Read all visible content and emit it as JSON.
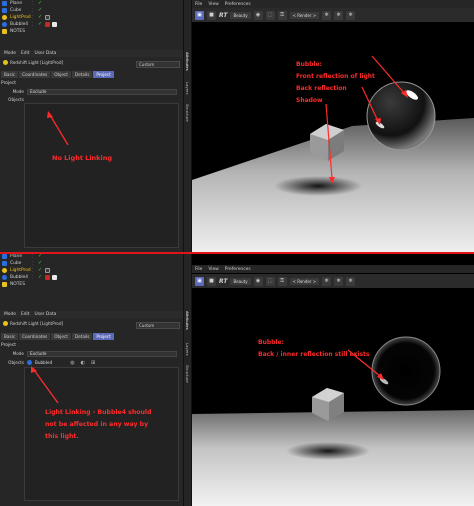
{
  "top": {
    "objects": [
      {
        "name": "Plane",
        "color": "#2a6ee0",
        "tags": []
      },
      {
        "name": "Cube",
        "color": "#2a6ee0",
        "tags": []
      },
      {
        "name": "LightProd",
        "color": "#e8c21c",
        "tags": [
          "dark"
        ]
      },
      {
        "name": "Bubble4",
        "color": "#2a6ee0",
        "tags": [
          "red",
          "white"
        ]
      },
      {
        "name": "NOTES",
        "color": "#e8c21c",
        "tags": []
      }
    ],
    "menu": [
      "Mode",
      "Edit",
      "User Data"
    ],
    "object_title": "Redshift Light [LightProd]",
    "layout_select": "Custom",
    "tabs": [
      {
        "label": "Basic",
        "active": false
      },
      {
        "label": "Coordinates",
        "active": false
      },
      {
        "label": "Object",
        "active": false
      },
      {
        "label": "Details",
        "active": false
      },
      {
        "label": "Project",
        "active": true
      }
    ],
    "section": "Project",
    "mode_label": "Mode",
    "mode_value": "Exclude",
    "objects_label": "Objects",
    "annotation": "No Light Linking",
    "viewport": {
      "menu": [
        "File",
        "View",
        "Preferences"
      ],
      "renderer": "Beauty",
      "render_select": "< Render >",
      "rt": "RT",
      "annotations": [
        "Bubble:",
        "Front reflection of light",
        "Back reflection",
        "Shadow"
      ]
    }
  },
  "bottom": {
    "objects": [
      {
        "name": "Plane",
        "color": "#2a6ee0",
        "tags": []
      },
      {
        "name": "Cube",
        "color": "#2a6ee0",
        "tags": []
      },
      {
        "name": "LightProd",
        "color": "#e8c21c",
        "tags": [
          "dark"
        ]
      },
      {
        "name": "Bubble4",
        "color": "#2a6ee0",
        "tags": [
          "red",
          "white"
        ]
      },
      {
        "name": "NOTES",
        "color": "#e8c21c",
        "tags": []
      }
    ],
    "menu": [
      "Mode",
      "Edit",
      "User Data"
    ],
    "object_title": "Redshift Light [LightProd]",
    "layout_select": "Custom",
    "tabs": [
      {
        "label": "Basic",
        "active": false
      },
      {
        "label": "Coordinates",
        "active": false
      },
      {
        "label": "Object",
        "active": false
      },
      {
        "label": "Details",
        "active": false
      },
      {
        "label": "Project",
        "active": true
      }
    ],
    "section": "Project",
    "mode_label": "Mode",
    "mode_value": "Exclude",
    "objects_label": "Objects",
    "linked_object": "Bubble4",
    "annotation_lines": [
      "Light Linking - Bubble4 should",
      "not be affected in any way by",
      "this light."
    ],
    "viewport": {
      "menu": [
        "File",
        "View",
        "Preferences"
      ],
      "renderer": "Beauty",
      "render_select": "< Render >",
      "rt": "RT",
      "annotations": [
        "Bubble:",
        "Back / inner reflection still exists"
      ]
    }
  },
  "strip_tabs": [
    "Attributes",
    "Layers",
    "Structure"
  ],
  "colors": {
    "annotation": "#ff2b2b",
    "accent": "#5d6ab8",
    "divider": "#e0141a"
  }
}
